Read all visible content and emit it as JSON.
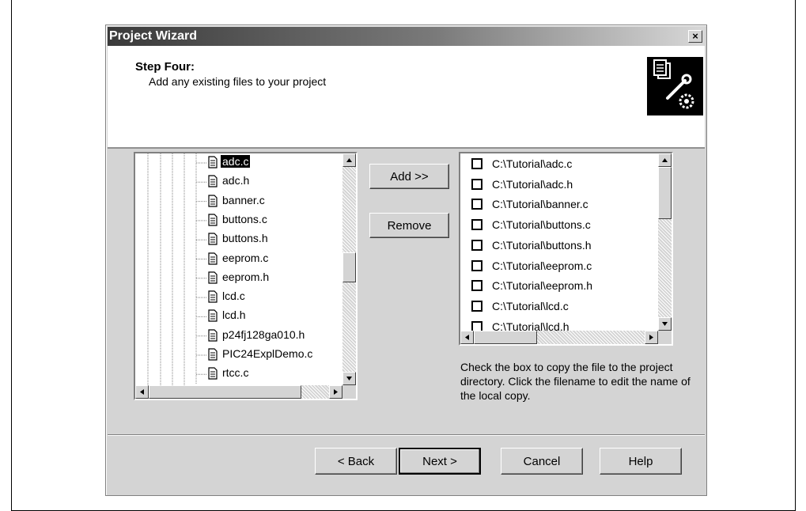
{
  "dialog": {
    "title": "Project Wizard",
    "close_label": "×"
  },
  "header": {
    "step_title": "Step Four:",
    "step_desc": "Add any existing files to your project",
    "icon": "wizard-tools-icon"
  },
  "tree": {
    "items": [
      {
        "label": "adc.c",
        "selected": true
      },
      {
        "label": "adc.h"
      },
      {
        "label": "banner.c"
      },
      {
        "label": "buttons.c"
      },
      {
        "label": "buttons.h"
      },
      {
        "label": "eeprom.c"
      },
      {
        "label": "eeprom.h"
      },
      {
        "label": "lcd.c"
      },
      {
        "label": "lcd.h"
      },
      {
        "label": "p24fj128ga010.h"
      },
      {
        "label": "PIC24ExplDemo.c"
      },
      {
        "label": "rtcc.c"
      }
    ]
  },
  "buttons": {
    "add": "Add >>",
    "remove": "Remove",
    "back": "< Back",
    "next": "Next >",
    "cancel": "Cancel",
    "help": "Help"
  },
  "files": {
    "items": [
      {
        "path": "C:\\Tutorial\\adc.c",
        "checked": false
      },
      {
        "path": "C:\\Tutorial\\adc.h",
        "checked": false
      },
      {
        "path": "C:\\Tutorial\\banner.c",
        "checked": false
      },
      {
        "path": "C:\\Tutorial\\buttons.c",
        "checked": false
      },
      {
        "path": "C:\\Tutorial\\buttons.h",
        "checked": false
      },
      {
        "path": "C:\\Tutorial\\eeprom.c",
        "checked": false
      },
      {
        "path": "C:\\Tutorial\\eeprom.h",
        "checked": false
      },
      {
        "path": "C:\\Tutorial\\lcd.c",
        "checked": false
      },
      {
        "path": "C:\\Tutorial\\lcd.h",
        "checked": false
      }
    ]
  },
  "hint": "Check the box to copy the file to the project directory.  Click the filename to edit the name of the local copy."
}
